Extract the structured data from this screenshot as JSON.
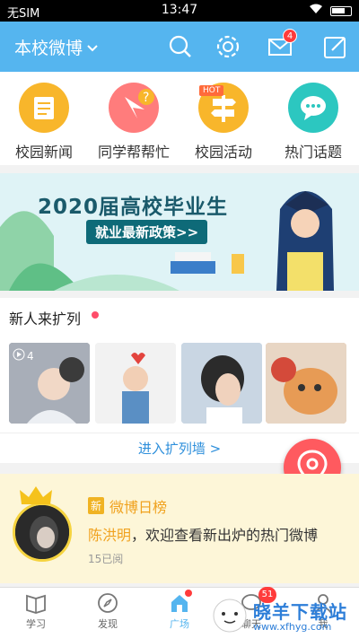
{
  "status_bar": {
    "carrier": "无SIM",
    "time": "13:47"
  },
  "header": {
    "school_label": "本校微博",
    "mail_badge": "4"
  },
  "quick_menu": [
    {
      "label": "校园新闻"
    },
    {
      "label": "同学帮帮忙"
    },
    {
      "label": "校园活动",
      "tag": "HOT"
    },
    {
      "label": "热门话题"
    }
  ],
  "banner": {
    "title": "2020届高校毕业生",
    "subtitle": "就业最新政策>>"
  },
  "new_people": {
    "title": "新人来扩列",
    "video_badge": "4",
    "more_link": "进入扩列墙 >"
  },
  "weibo_rank": {
    "tag": "新",
    "title": "微博日榜",
    "name": "陈洪明",
    "message": "，欢迎查看新出炉的热门微博",
    "read_count": "15已阅"
  },
  "tabbar": {
    "items": [
      {
        "label": "学习"
      },
      {
        "label": "发现"
      },
      {
        "label": "广场"
      },
      {
        "label": "聊天"
      },
      {
        "label": "我"
      }
    ],
    "chat_badge": "51"
  },
  "watermark": {
    "text": "晓羊下载站",
    "url": "www.xfhyg.com"
  },
  "colors": {
    "primary": "#55b5ef",
    "accent": "#ff5a5f",
    "rank_bg": "#fdf6d8"
  }
}
